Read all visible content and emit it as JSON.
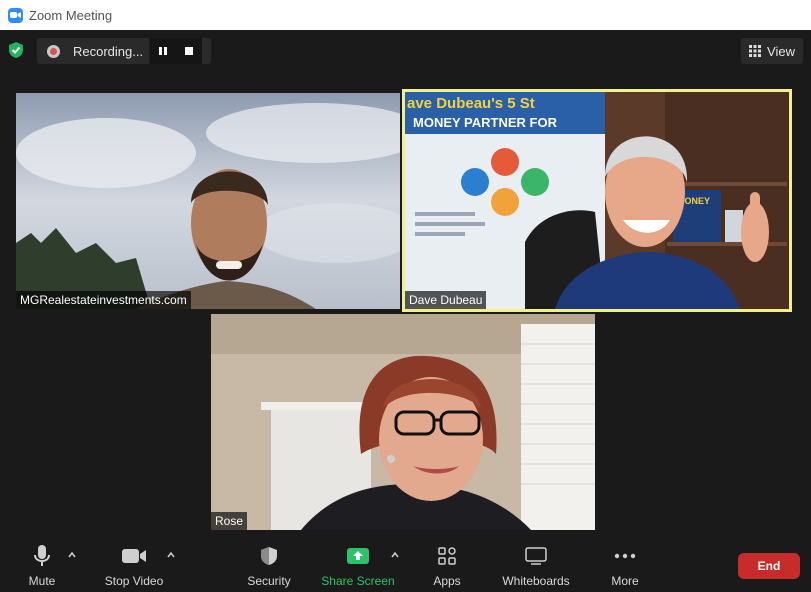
{
  "window": {
    "title": "Zoom Meeting"
  },
  "topbar": {
    "recording_label": "Recording...",
    "view_label": "View"
  },
  "participants": [
    {
      "name": "MGRealestateinvestments.com",
      "active_speaker": false
    },
    {
      "name": "Dave Dubeau",
      "active_speaker": true,
      "banner_text": "ave Dubeau's 5 St",
      "banner_sub": "MONEY PARTNER FOR",
      "book_text": "MONEY"
    },
    {
      "name": "Rose",
      "active_speaker": false
    }
  ],
  "toolbar": {
    "mute": "Mute",
    "stop_video": "Stop Video",
    "security": "Security",
    "share_screen": "Share Screen",
    "apps": "Apps",
    "whiteboards": "Whiteboards",
    "more": "More",
    "end": "End"
  },
  "colors": {
    "active_speaker_border": "#f2f08a",
    "share_green": "#29c46a",
    "end_red": "#c72b2b",
    "shield_green": "#23b35c"
  }
}
